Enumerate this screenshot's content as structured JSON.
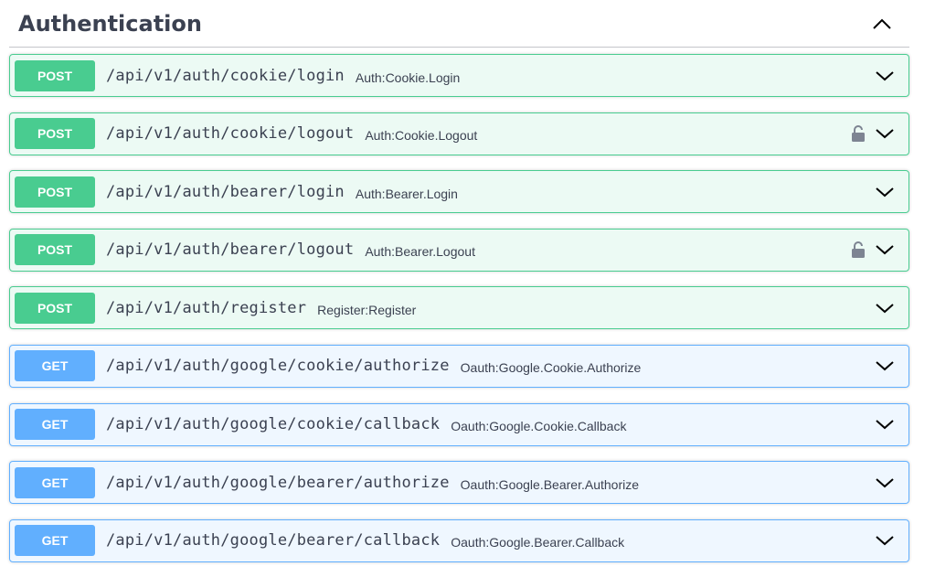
{
  "section": {
    "title": "Authentication",
    "toggle_icon": "chevron-up-icon"
  },
  "colors": {
    "post": "#49cc90",
    "get": "#61affe",
    "text": "#3b4151",
    "lock": "#7d8492"
  },
  "operations": [
    {
      "method": "POST",
      "path": "/api/v1/auth/cookie/login",
      "summary": "Auth:Cookie.Login",
      "locked": false
    },
    {
      "method": "POST",
      "path": "/api/v1/auth/cookie/logout",
      "summary": "Auth:Cookie.Logout",
      "locked": true
    },
    {
      "method": "POST",
      "path": "/api/v1/auth/bearer/login",
      "summary": "Auth:Bearer.Login",
      "locked": false
    },
    {
      "method": "POST",
      "path": "/api/v1/auth/bearer/logout",
      "summary": "Auth:Bearer.Logout",
      "locked": true
    },
    {
      "method": "POST",
      "path": "/api/v1/auth/register",
      "summary": "Register:Register",
      "locked": false
    },
    {
      "method": "GET",
      "path": "/api/v1/auth/google/cookie/authorize",
      "summary": "Oauth:Google.Cookie.Authorize",
      "locked": false
    },
    {
      "method": "GET",
      "path": "/api/v1/auth/google/cookie/callback",
      "summary": "Oauth:Google.Cookie.Callback",
      "locked": false
    },
    {
      "method": "GET",
      "path": "/api/v1/auth/google/bearer/authorize",
      "summary": "Oauth:Google.Bearer.Authorize",
      "locked": false
    },
    {
      "method": "GET",
      "path": "/api/v1/auth/google/bearer/callback",
      "summary": "Oauth:Google.Bearer.Callback",
      "locked": false
    }
  ]
}
